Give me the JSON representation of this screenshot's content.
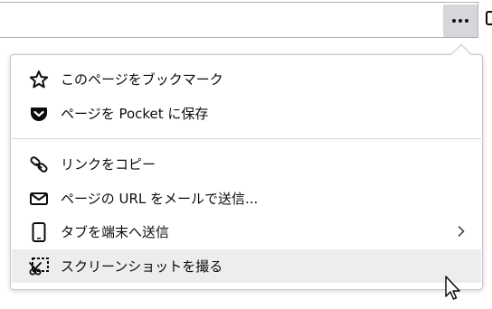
{
  "toolbar": {
    "page_actions_button": "page-actions-menu"
  },
  "menu": {
    "items": [
      {
        "label": "このページをブックマーク",
        "icon": "star-icon"
      },
      {
        "label": "ページを Pocket に保存",
        "icon": "pocket-icon"
      },
      {
        "label": "リンクをコピー",
        "icon": "link-icon"
      },
      {
        "label": "ページの URL をメールで送信...",
        "icon": "mail-icon"
      },
      {
        "label": "タブを端末へ送信",
        "icon": "device-icon",
        "has_submenu": true
      },
      {
        "label": "スクリーンショットを撮る",
        "icon": "screenshot-icon",
        "highlighted": true
      }
    ]
  },
  "colors": {
    "highlight": "#ededf0",
    "button_active": "#d7d7db",
    "text": "#0c0c0d"
  }
}
